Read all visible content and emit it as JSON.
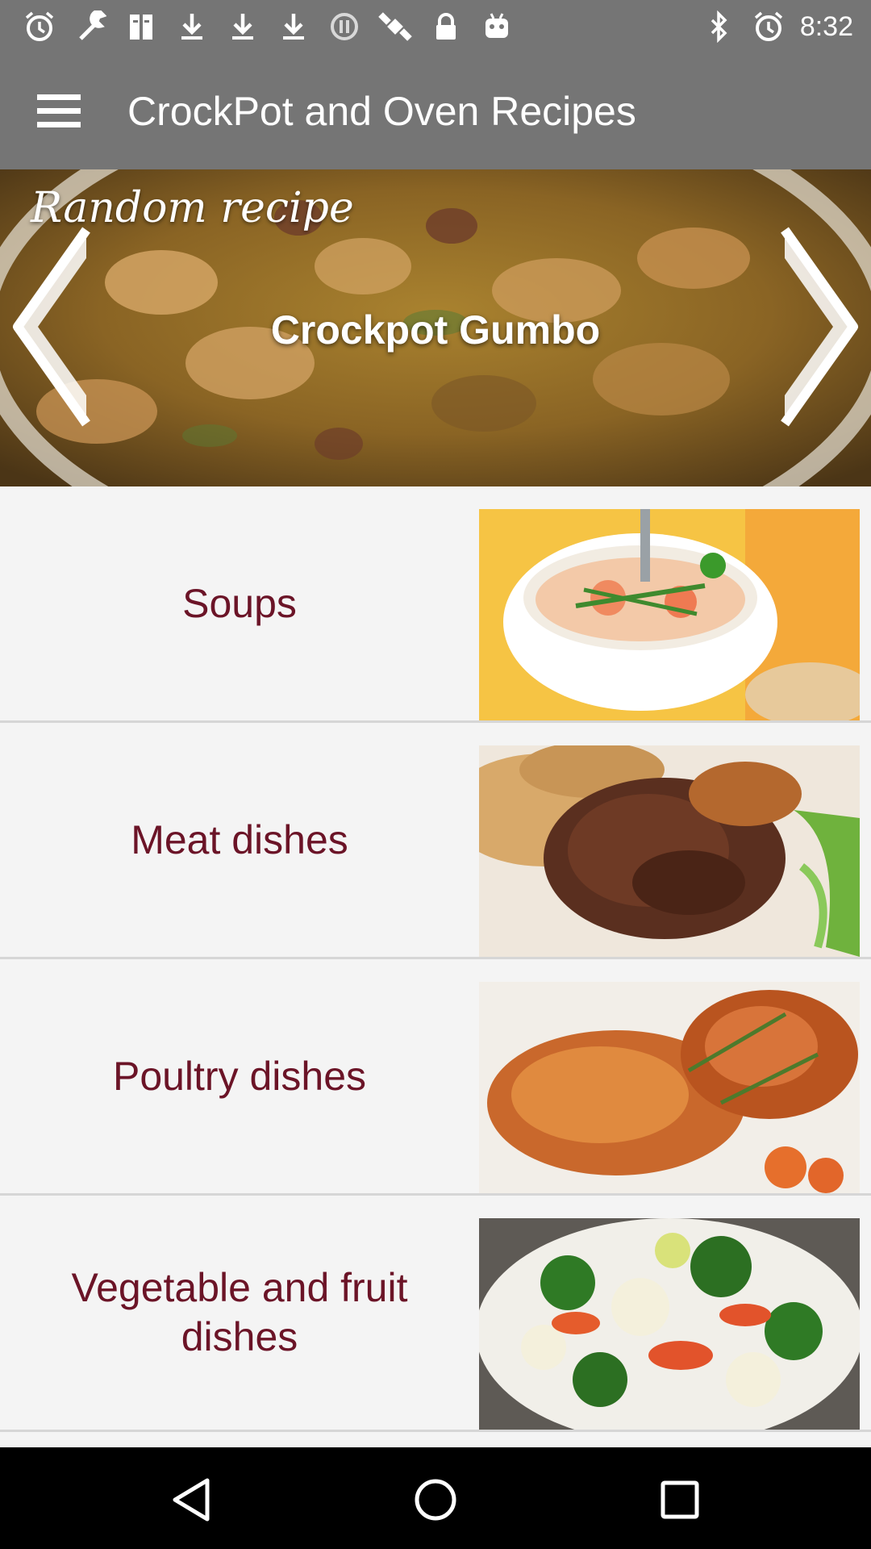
{
  "status_bar": {
    "time": "8:32",
    "icons": [
      "alarm-icon",
      "wrench-icon",
      "book-icon",
      "download-icon",
      "download-icon",
      "download-icon",
      "blocked-icon",
      "satellite-icon",
      "lock-icon",
      "robot-icon",
      "bluetooth-icon",
      "alarm-icon"
    ]
  },
  "app_bar": {
    "title": "CrockPot and Oven Recipes",
    "menu_icon": "hamburger-menu-icon"
  },
  "hero": {
    "caption": "Random recipe",
    "recipe_title": "Crockpot Gumbo",
    "prev_icon": "chevron-left-icon",
    "next_icon": "chevron-right-icon"
  },
  "categories": [
    {
      "label": "Soups",
      "image": "soup-photo"
    },
    {
      "label": "Meat dishes",
      "image": "meat-photo"
    },
    {
      "label": "Poultry dishes",
      "image": "poultry-photo"
    },
    {
      "label": "Vegetable and fruit dishes",
      "image": "vegetable-photo"
    }
  ],
  "nav_bar": {
    "back_icon": "back-triangle-icon",
    "home_icon": "home-circle-icon",
    "recents_icon": "recents-square-icon"
  },
  "colors": {
    "app_bar": "#757575",
    "category_text": "#6b1427",
    "list_background": "#f4f4f4",
    "divider": "#d6d6d6"
  }
}
